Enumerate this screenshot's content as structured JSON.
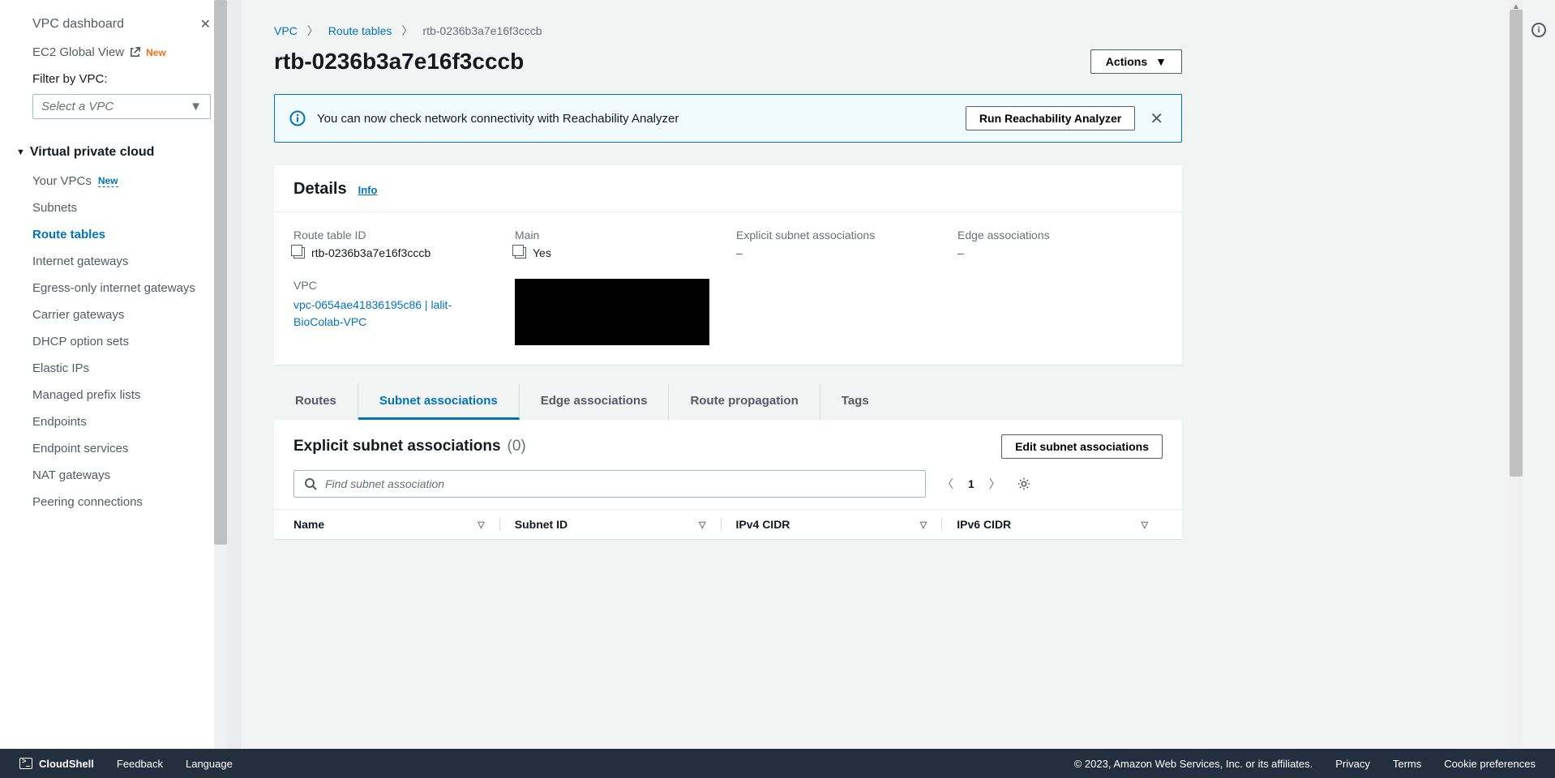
{
  "sidebar": {
    "dashboard": "VPC dashboard",
    "ec2_global": "EC2 Global View",
    "new_badge": "New",
    "filter_label": "Filter by VPC:",
    "select_placeholder": "Select a VPC",
    "section": "Virtual private cloud",
    "items": [
      {
        "label": "Your VPCs",
        "new": true
      },
      {
        "label": "Subnets"
      },
      {
        "label": "Route tables",
        "active": true
      },
      {
        "label": "Internet gateways"
      },
      {
        "label": "Egress-only internet gateways"
      },
      {
        "label": "Carrier gateways"
      },
      {
        "label": "DHCP option sets"
      },
      {
        "label": "Elastic IPs"
      },
      {
        "label": "Managed prefix lists"
      },
      {
        "label": "Endpoints"
      },
      {
        "label": "Endpoint services"
      },
      {
        "label": "NAT gateways"
      },
      {
        "label": "Peering connections"
      }
    ]
  },
  "breadcrumb": {
    "root": "VPC",
    "parent": "Route tables",
    "current": "rtb-0236b3a7e16f3cccb"
  },
  "page": {
    "title": "rtb-0236b3a7e16f3cccb",
    "actions": "Actions"
  },
  "banner": {
    "text": "You can now check network connectivity with Reachability Analyzer",
    "button": "Run Reachability Analyzer"
  },
  "details": {
    "heading": "Details",
    "info": "Info",
    "route_table_id": {
      "label": "Route table ID",
      "value": "rtb-0236b3a7e16f3cccb"
    },
    "main": {
      "label": "Main",
      "value": "Yes"
    },
    "explicit": {
      "label": "Explicit subnet associations",
      "value": "–"
    },
    "edge": {
      "label": "Edge associations",
      "value": "–"
    },
    "vpc": {
      "label": "VPC",
      "value": "vpc-0654ae41836195c86 | lalit-BioColab-VPC"
    }
  },
  "tabs": {
    "routes": "Routes",
    "subnet_assoc": "Subnet associations",
    "edge_assoc": "Edge associations",
    "route_prop": "Route propagation",
    "tags": "Tags"
  },
  "subnet": {
    "heading": "Explicit subnet associations",
    "count": "(0)",
    "edit_btn": "Edit subnet associations",
    "search_placeholder": "Find subnet association",
    "page_num": "1",
    "columns": {
      "name": "Name",
      "subnet_id": "Subnet ID",
      "ipv4": "IPv4 CIDR",
      "ipv6": "IPv6 CIDR"
    }
  },
  "footer": {
    "cloudshell": "CloudShell",
    "feedback": "Feedback",
    "language": "Language",
    "copyright": "© 2023, Amazon Web Services, Inc. or its affiliates.",
    "privacy": "Privacy",
    "terms": "Terms",
    "cookies": "Cookie preferences"
  }
}
